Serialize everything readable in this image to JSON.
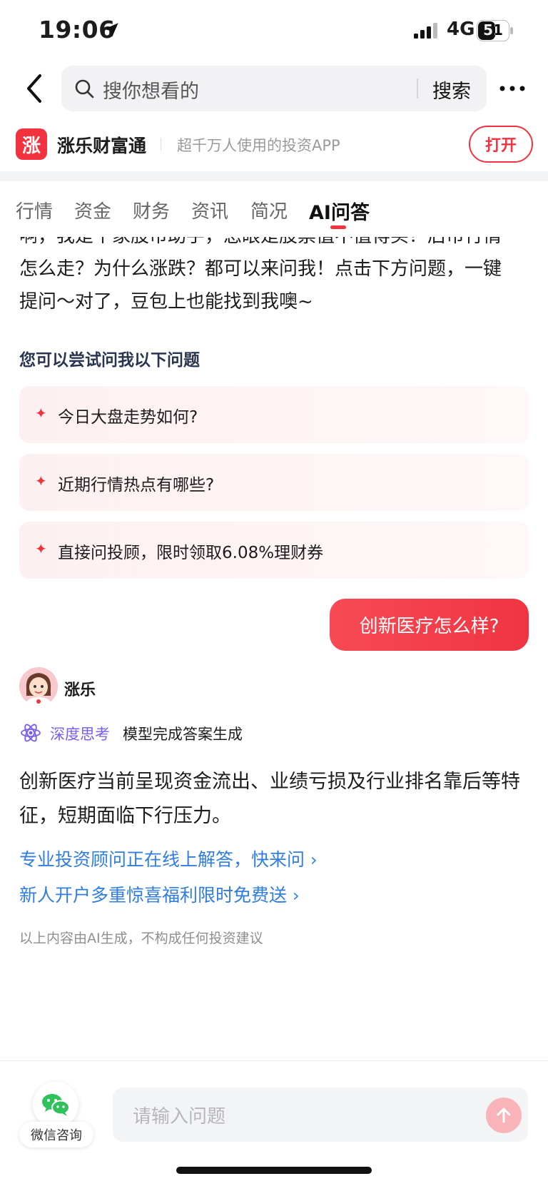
{
  "status_bar": {
    "time": "19:06",
    "network": "4G",
    "battery": "51"
  },
  "search": {
    "placeholder": "搜你想看的",
    "button": "搜索"
  },
  "banner": {
    "logo_text": "涨",
    "app_name": "涨乐财富通",
    "slogan": "超千万人使用的投资APP",
    "open_button": "打开"
  },
  "tabs": [
    {
      "label": "行情",
      "active": false
    },
    {
      "label": "资金",
      "active": false
    },
    {
      "label": "财务",
      "active": false
    },
    {
      "label": "资讯",
      "active": false
    },
    {
      "label": "简况",
      "active": false
    },
    {
      "label": "AI问答",
      "active": true
    }
  ],
  "chat": {
    "intro_lines": [
      "啊，我是个家股市助手，您眼是股票值不值得买？后市行情",
      "怎么走？为什么涨跌？都可以来问我！点击下方问题，一键",
      "提问～对了，豆包上也能找到我噢~"
    ],
    "suggest_title": "您可以尝试问我以下问题",
    "suggestions": [
      "今日大盘走势如何?",
      "近期行情热点有哪些?",
      "直接问投顾，限时领取6.08%理财券"
    ],
    "user_message": "创新医疗怎么样?",
    "bot_name": "涨乐",
    "thinking_label": "深度思考",
    "thinking_status": "模型完成答案生成",
    "answer": "创新医疗当前呈现资金流出、业绩亏损及行业排名靠后等特征，短期面临下行压力。",
    "links": [
      "专业投资顾问正在线上解答，快来问",
      "新人开户多重惊喜福利限时免费送"
    ],
    "disclaimer": "以上内容由AI生成，不构成任何投资建议"
  },
  "bottom_bar": {
    "wechat_label": "微信咨询",
    "input_placeholder": "请输入问题"
  },
  "colors": {
    "accent": "#f2323f",
    "link": "#2f7de1",
    "thinking": "#7a5cf0"
  }
}
